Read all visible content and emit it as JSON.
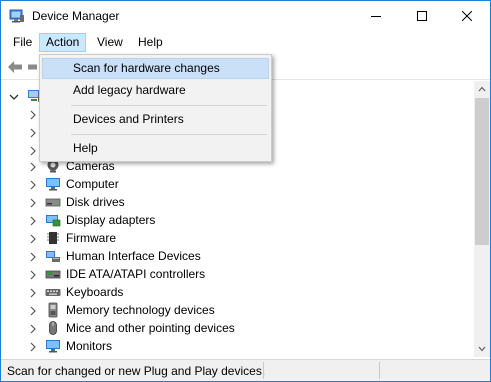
{
  "window": {
    "title": "Device Manager"
  },
  "menubar": {
    "items": [
      "File",
      "Action",
      "View",
      "Help"
    ],
    "active": "Action"
  },
  "action_menu": {
    "items": [
      {
        "label": "Scan for hardware changes",
        "highlighted": true
      },
      {
        "label": "Add legacy hardware",
        "highlighted": false
      },
      {
        "label": "Devices and Printers",
        "highlighted": false
      },
      {
        "label": "Help",
        "highlighted": false
      }
    ]
  },
  "tree": {
    "categories": [
      {
        "label": "Cameras",
        "icon": "camera-icon"
      },
      {
        "label": "Computer",
        "icon": "computer-icon"
      },
      {
        "label": "Disk drives",
        "icon": "disk-drive-icon"
      },
      {
        "label": "Display adapters",
        "icon": "display-adapter-icon"
      },
      {
        "label": "Firmware",
        "icon": "firmware-chip-icon"
      },
      {
        "label": "Human Interface Devices",
        "icon": "hid-icon"
      },
      {
        "label": "IDE ATA/ATAPI controllers",
        "icon": "ide-controller-icon"
      },
      {
        "label": "Keyboards",
        "icon": "keyboard-icon"
      },
      {
        "label": "Memory technology devices",
        "icon": "memory-device-icon"
      },
      {
        "label": "Mice and other pointing devices",
        "icon": "mouse-icon"
      },
      {
        "label": "Monitors",
        "icon": "monitor-icon"
      }
    ]
  },
  "statusbar": {
    "text": "Scan for changed or new Plug and Play devices."
  },
  "colors": {
    "accent": "#1e7fd6",
    "menu_highlight": "#c9e0f7",
    "menu_active": "#cce8ff"
  }
}
